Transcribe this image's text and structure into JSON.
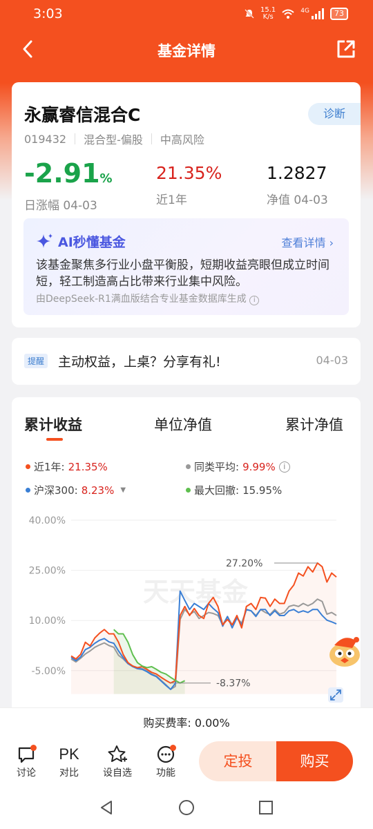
{
  "status": {
    "time": "3:03",
    "speed_top": "15.1",
    "speed_bottom": "K/s",
    "network": "4G",
    "battery": "73"
  },
  "nav": {
    "title": "基金详情"
  },
  "fund": {
    "name": "永赢睿信混合C",
    "diag_label": "诊断",
    "code": "019432",
    "type": "混合型-偏股",
    "risk": "中高风险",
    "daily_change": "-2.91",
    "daily_change_unit": "%",
    "daily_label": "日涨幅 04-03",
    "one_year": "21.35%",
    "one_year_label": "近1年",
    "nav_value": "1.2827",
    "nav_label": "净值 04-03"
  },
  "ai": {
    "title": "AI秒懂基金",
    "more": "查看详情",
    "text": "该基金聚焦多行业小盘平衡股，短期收益亮眼但成立时间短，轻工制造高占比带来行业集中风险。",
    "source": "由DeepSeek-R1满血版结合专业基金数据库生成"
  },
  "notice": {
    "tag": "提醒",
    "text": "主动权益，上桌？分享有礼!",
    "date": "04-03"
  },
  "tabs": [
    "累计收益",
    "单位净值",
    "累计净值"
  ],
  "legend": [
    {
      "label": "近1年:",
      "value": "21.35%",
      "color": "#f4501f",
      "value_red": true
    },
    {
      "label": "同类平均:",
      "value": "9.99%",
      "color": "#999999",
      "value_red": true
    },
    {
      "label": "沪深300:",
      "value": "8.23%",
      "color": "#3a7fd5",
      "value_red": true
    },
    {
      "label": "最大回撤:",
      "value": "15.95%",
      "color": "#5fbf4f",
      "value_red": false
    }
  ],
  "watermark": "天天基金",
  "chart_data": {
    "type": "line",
    "ylim": [
      -12,
      40
    ],
    "yticks": [
      "40.00%",
      "25.00%",
      "10.00%",
      "-5.00%"
    ],
    "annotations": {
      "max": "27.20%",
      "min": "-8.37%"
    },
    "series": [
      {
        "name": "近1年",
        "color": "#f4501f",
        "values": [
          -0.6,
          -1.5,
          -0.1,
          3.5,
          2.4,
          4.8,
          6.2,
          7.3,
          6.0,
          6.0,
          3.5,
          -0.2,
          -2.6,
          -3.6,
          -4.1,
          -3.8,
          -4.6,
          -5.5,
          -6.0,
          -7.0,
          -7.9,
          -8.7,
          -8.0,
          11.5,
          14.2,
          11.5,
          13.6,
          11.5,
          10.6,
          15.1,
          16.9,
          14.2,
          8.7,
          10.3,
          8.7,
          11.5,
          7.8,
          14.2,
          15.1,
          13.3,
          16.9,
          16.7,
          14.2,
          16.4,
          15.1,
          15.1,
          18.8,
          20.6,
          24.2,
          23.3,
          26.1,
          24.5,
          27.2,
          26.1,
          21.5,
          24.2,
          23.0
        ]
      },
      {
        "name": "同类平均",
        "color": "#999999",
        "values": [
          -1.5,
          -2.4,
          -1.3,
          0.0,
          0.9,
          2.0,
          2.7,
          3.3,
          2.5,
          2.0,
          -0.4,
          -1.5,
          -2.9,
          -3.6,
          -4.2,
          -4.4,
          -5.1,
          -6.0,
          -6.6,
          -7.9,
          -9.2,
          -10.6,
          -9.7,
          10.3,
          13.3,
          11.8,
          12.7,
          10.6,
          11.5,
          12.4,
          12.1,
          11.5,
          8.7,
          11.2,
          8.7,
          10.8,
          9.2,
          13.3,
          12.9,
          11.5,
          13.3,
          12.4,
          11.8,
          13.3,
          11.9,
          12.4,
          14.2,
          14.6,
          14.2,
          15.1,
          14.4,
          15.1,
          16.4,
          15.7,
          11.9,
          12.4,
          11.5
        ]
      },
      {
        "name": "沪深300",
        "color": "#3a7fd5",
        "values": [
          -1.0,
          -2.0,
          -0.9,
          1.3,
          2.0,
          3.2,
          4.1,
          4.6,
          3.6,
          3.2,
          0.9,
          -1.1,
          -2.9,
          -3.8,
          -4.4,
          -4.6,
          -5.3,
          -6.2,
          -6.8,
          -8.1,
          -9.4,
          -10.6,
          -8.8,
          18.8,
          16.0,
          13.3,
          15.1,
          14.2,
          13.3,
          15.1,
          13.6,
          12.4,
          8.3,
          11.2,
          7.8,
          10.8,
          8.7,
          13.3,
          12.9,
          11.2,
          13.3,
          13.3,
          11.5,
          12.9,
          11.5,
          11.5,
          12.9,
          13.3,
          12.4,
          12.9,
          12.4,
          13.3,
          13.3,
          11.5,
          10.1,
          9.6,
          9.0
        ]
      },
      {
        "name": "最大回撤",
        "color": "#5fbf4f",
        "values": [
          7.3,
          6.0,
          6.0,
          3.5,
          -0.2,
          -2.6,
          -3.6,
          -4.1,
          -3.8,
          -4.6,
          -5.5,
          -6.0,
          -7.0,
          -7.9,
          -8.7,
          -8.0
        ]
      }
    ]
  }
}
